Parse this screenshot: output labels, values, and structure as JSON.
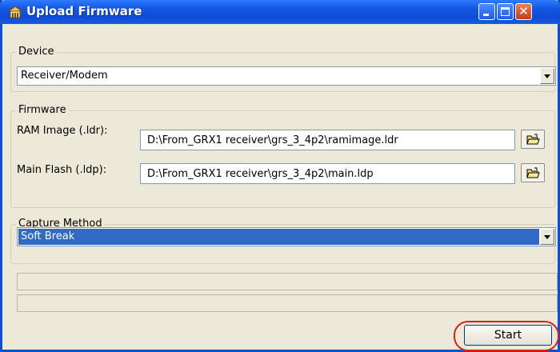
{
  "window": {
    "title": "Upload Firmware",
    "app_icon": "app-icon"
  },
  "device": {
    "legend": "Device",
    "selected": "Receiver/Modem"
  },
  "firmware": {
    "legend": "Firmware",
    "ram_label": "RAM Image (.ldr):",
    "ram_value": "D:\\From_GRX1 receiver\\grs_3_4p2\\ramimage.ldr",
    "flash_label": "Main Flash (.ldp):",
    "flash_value": "D:\\From_GRX1 receiver\\grs_3_4p2\\main.ldp",
    "browse_icon": "folder-open-icon"
  },
  "capture": {
    "legend": "Capture Method",
    "selected": "Soft Break"
  },
  "actions": {
    "start_label": "Start"
  },
  "colors": {
    "titlebar": "#0d4bd6",
    "selection": "#316ac5",
    "highlight": "#d8201a",
    "background": "#ece9d8"
  }
}
